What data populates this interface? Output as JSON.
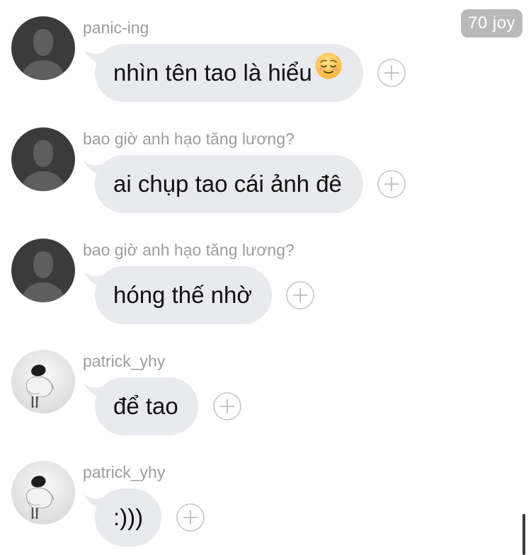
{
  "badge": {
    "label": "70 joy"
  },
  "messages": [
    {
      "sender": "panic-ing",
      "text": "nhìn tên tao là hiểu",
      "emoji": "relieved-face",
      "avatar": "default-silhouette"
    },
    {
      "sender": "bao giờ anh hạo tăng lương?",
      "text": "ai chụp tao cái ảnh đê",
      "avatar": "default-silhouette"
    },
    {
      "sender": "bao giờ anh hạo tăng lương?",
      "text": "hóng thế nhờ",
      "avatar": "default-silhouette"
    },
    {
      "sender": "patrick_yhy",
      "text": "để tao",
      "avatar": "photo"
    },
    {
      "sender": "patrick_yhy",
      "text": ":)))",
      "avatar": "photo"
    }
  ],
  "icons": {
    "react": "plus-circle-icon",
    "avatar_default": "person-silhouette-icon"
  },
  "colors": {
    "bubble": "#e9eaed",
    "badge": "#b9b9b9",
    "sender": "#9d9d9d"
  }
}
